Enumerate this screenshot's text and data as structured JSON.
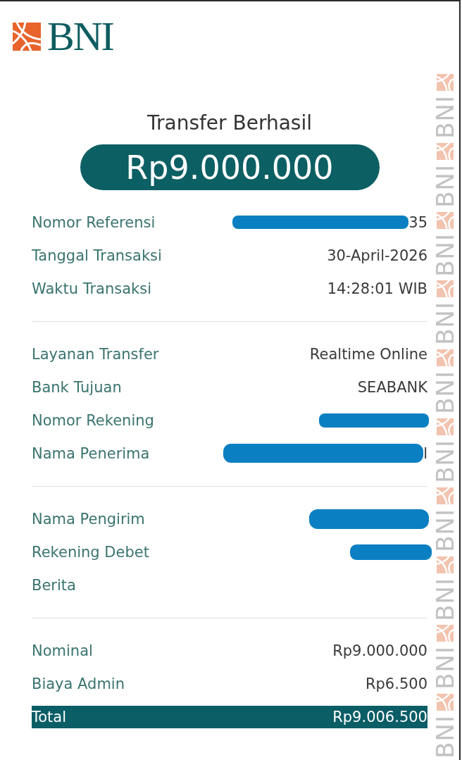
{
  "logo": {
    "text": "BNI"
  },
  "title": "Transfer Berhasil",
  "amount": "Rp9.000.000",
  "sections": [
    {
      "rows": [
        {
          "label": "Nomor Referensi",
          "value": "35",
          "redacted": true,
          "highlighted": false
        },
        {
          "label": "Tanggal Transaksi",
          "value": "30-April-2026",
          "redacted": false,
          "highlighted": false
        },
        {
          "label": "Waktu Transaksi",
          "value": "14:28:01 WIB",
          "redacted": false,
          "highlighted": false
        }
      ]
    },
    {
      "rows": [
        {
          "label": "Layanan Transfer",
          "value": "Realtime Online",
          "redacted": false,
          "highlighted": false
        },
        {
          "label": "Bank Tujuan",
          "value": "SEABANK",
          "redacted": false,
          "highlighted": false
        },
        {
          "label": "Nomor Rekening",
          "redacted": true,
          "highlighted": false
        },
        {
          "label": "Nama Penerima",
          "value": "l",
          "redacted": true,
          "highlighted": false
        }
      ]
    },
    {
      "rows": [
        {
          "label": "Nama Pengirim",
          "redacted": true,
          "highlighted": false
        },
        {
          "label": "Rekening Debet",
          "redacted": true,
          "highlighted": false
        },
        {
          "label": "Berita",
          "redacted": false,
          "highlighted": false
        }
      ]
    },
    {
      "rows": [
        {
          "label": "Nominal",
          "value": "Rp9.000.000",
          "redacted": false,
          "highlighted": false
        },
        {
          "label": "Biaya Admin",
          "value": "Rp6.500",
          "redacted": false,
          "highlighted": false
        },
        {
          "label": "Total",
          "value": "Rp9.006.500",
          "redacted": false,
          "highlighted": true
        }
      ]
    }
  ],
  "security_pattern": [
    "BNI",
    "BNI",
    "BNI",
    "BNI",
    "BNI",
    "BNI",
    "BNI",
    "BNI",
    "BNI",
    "BNI"
  ]
}
